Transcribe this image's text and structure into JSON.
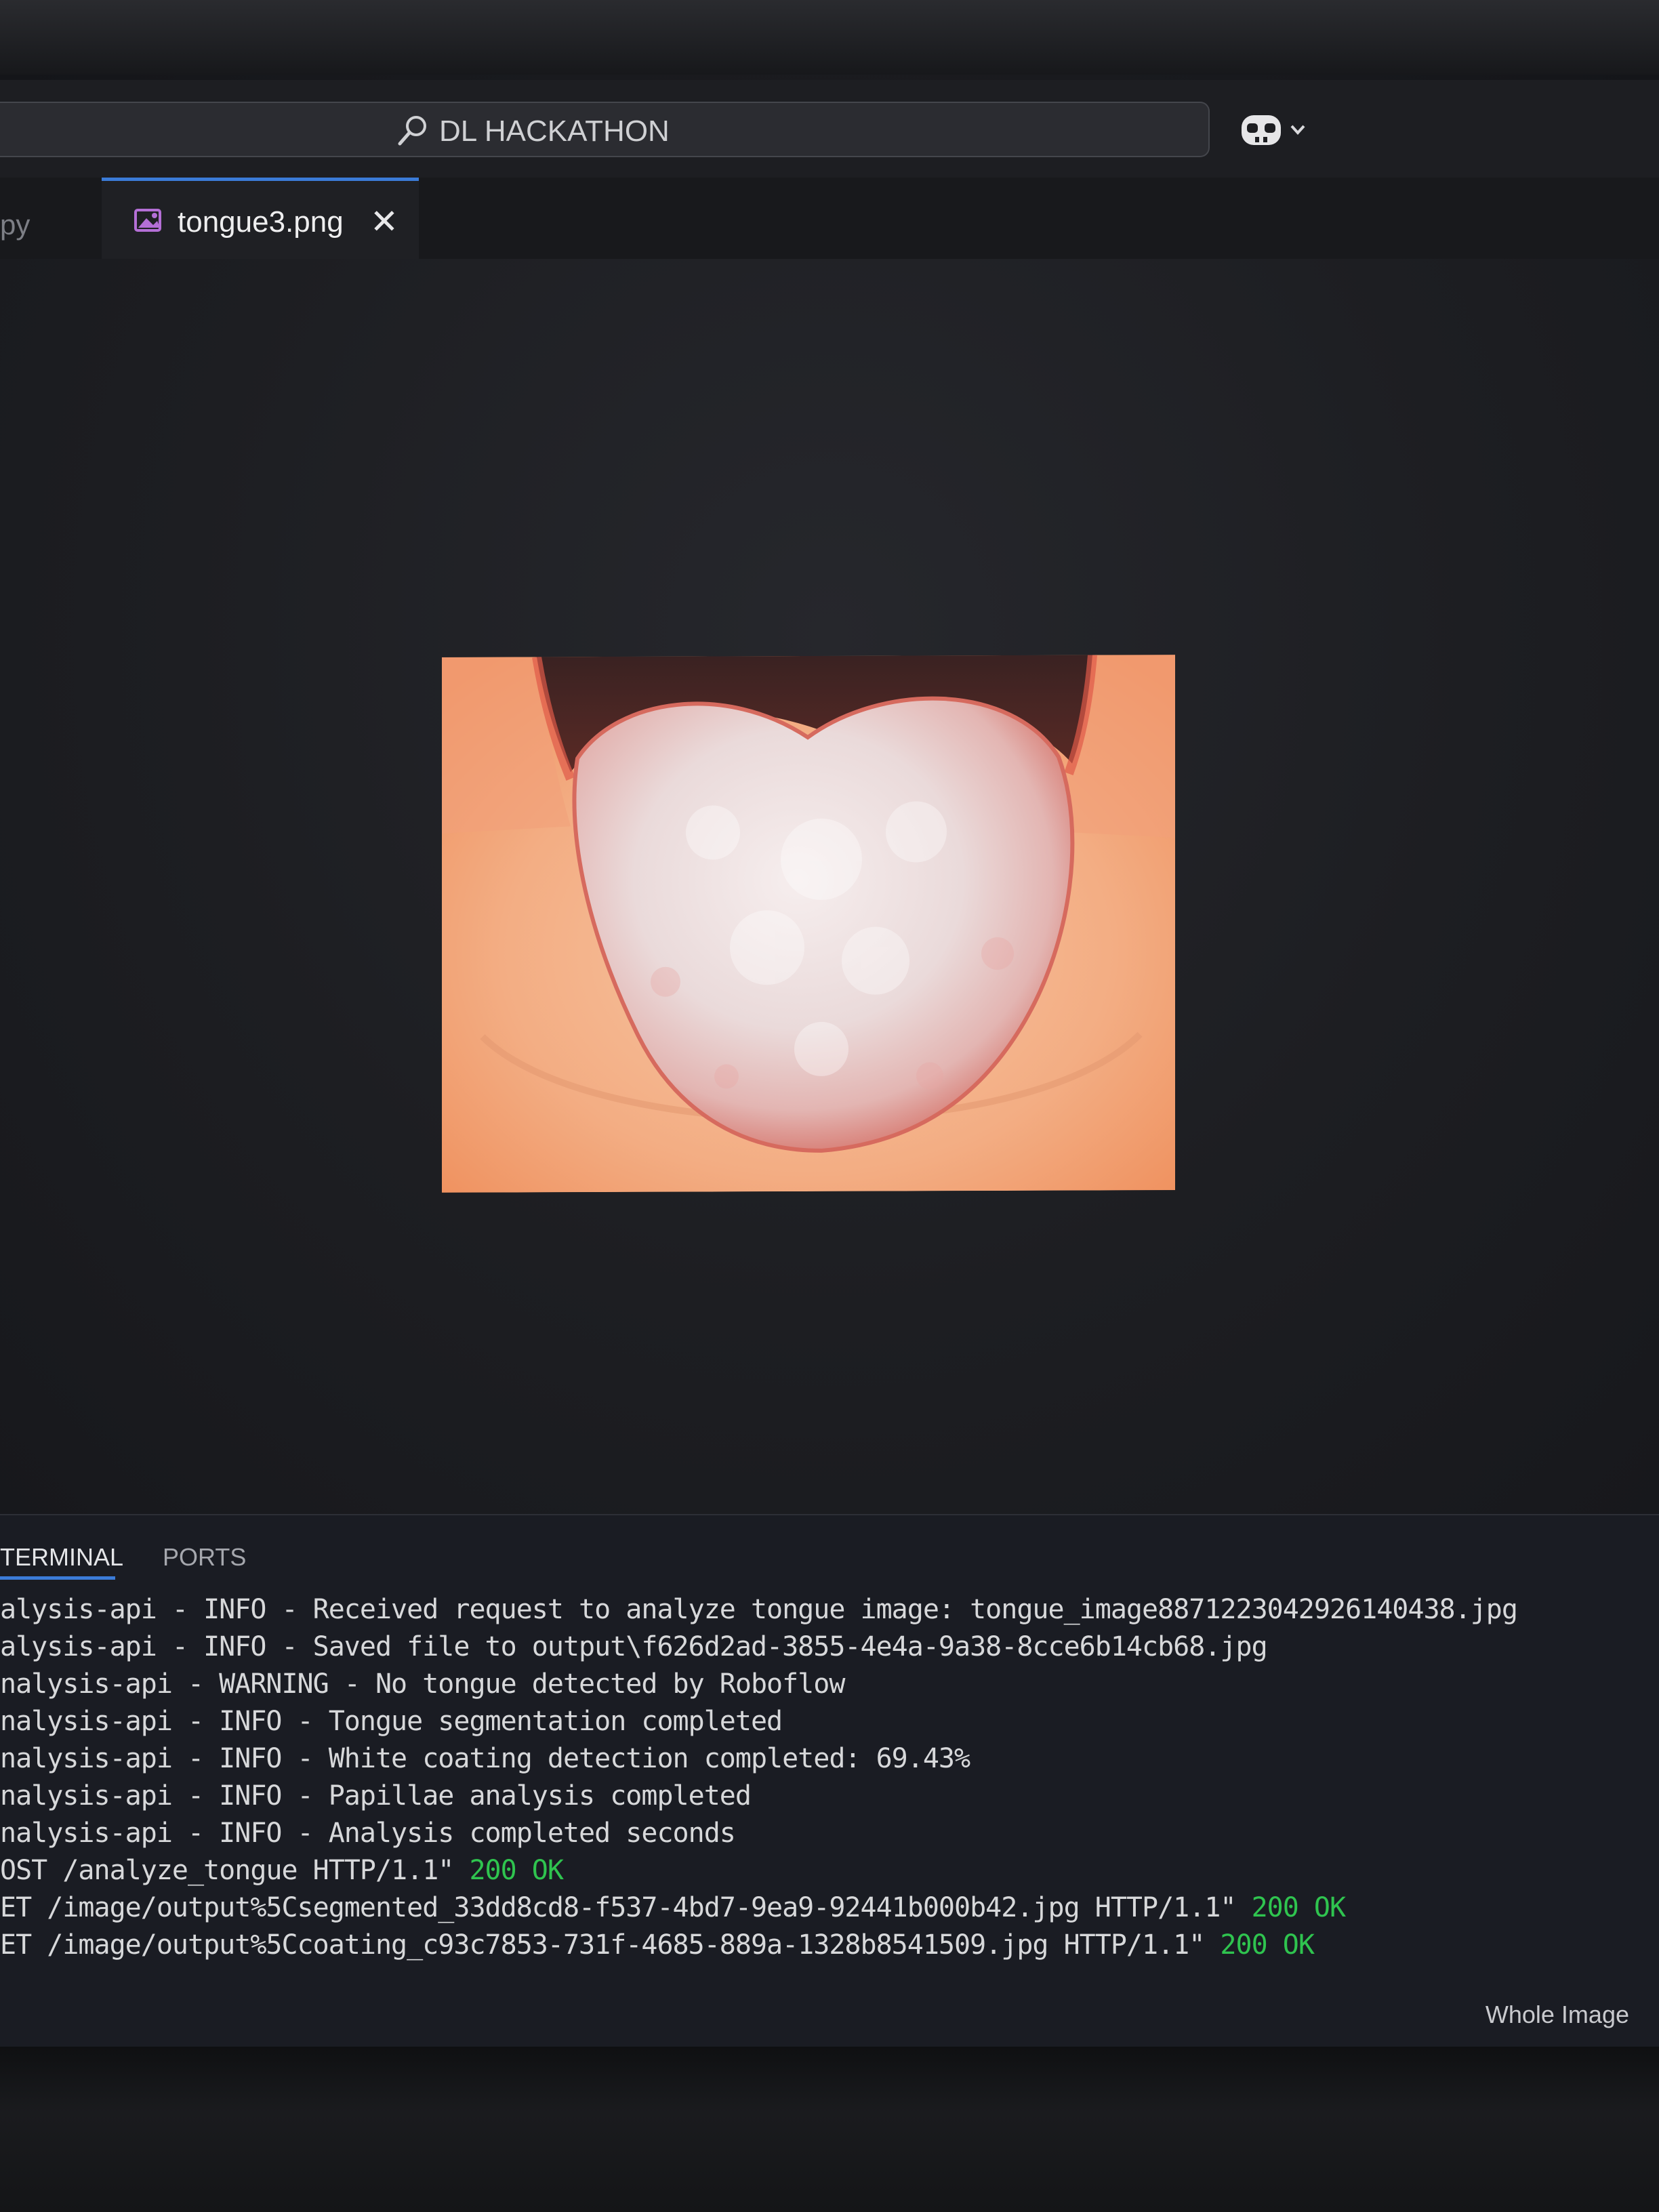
{
  "titlebar": {
    "search_text": "DL HACKATHON"
  },
  "tabs": {
    "previous_tab_label": "py",
    "active_tab_label": "tongue3.png"
  },
  "editor": {
    "image_description_icon": "image-preview"
  },
  "panel": {
    "tabs": [
      "TERMINAL",
      "PORTS"
    ],
    "terminal_lines": [
      {
        "text": "alysis-api - INFO - Received request to analyze tongue image: tongue_image8871223042926140438.jpg",
        "ok": ""
      },
      {
        "text": "alysis-api - INFO - Saved file to output\\f626d2ad-3855-4e4a-9a38-8cce6b14cb68.jpg",
        "ok": ""
      },
      {
        "text": "nalysis-api - WARNING - No tongue detected by Roboflow",
        "ok": ""
      },
      {
        "text": "nalysis-api - INFO - Tongue segmentation completed",
        "ok": ""
      },
      {
        "text": "nalysis-api - INFO - White coating detection completed: 69.43%",
        "ok": ""
      },
      {
        "text": "nalysis-api - INFO - Papillae analysis completed",
        "ok": ""
      },
      {
        "text": "nalysis-api - INFO - Analysis completed seconds",
        "ok": ""
      },
      {
        "text": "OST /analyze_tongue HTTP/1.1\" ",
        "ok": "200 OK"
      },
      {
        "text": "ET /image/output%5Csegmented_33dd8cd8-f537-4bd7-9ea9-92441b000b42.jpg HTTP/1.1\" ",
        "ok": "200 OK"
      },
      {
        "text": "ET /image/output%5Ccoating_c93c7853-731f-4685-889a-1328b8541509.jpg HTTP/1.1\" ",
        "ok": "200 OK"
      }
    ],
    "status_right": "Whole Image"
  },
  "colors": {
    "accent": "#3b7bd8",
    "ok_green": "#2fc44f"
  }
}
